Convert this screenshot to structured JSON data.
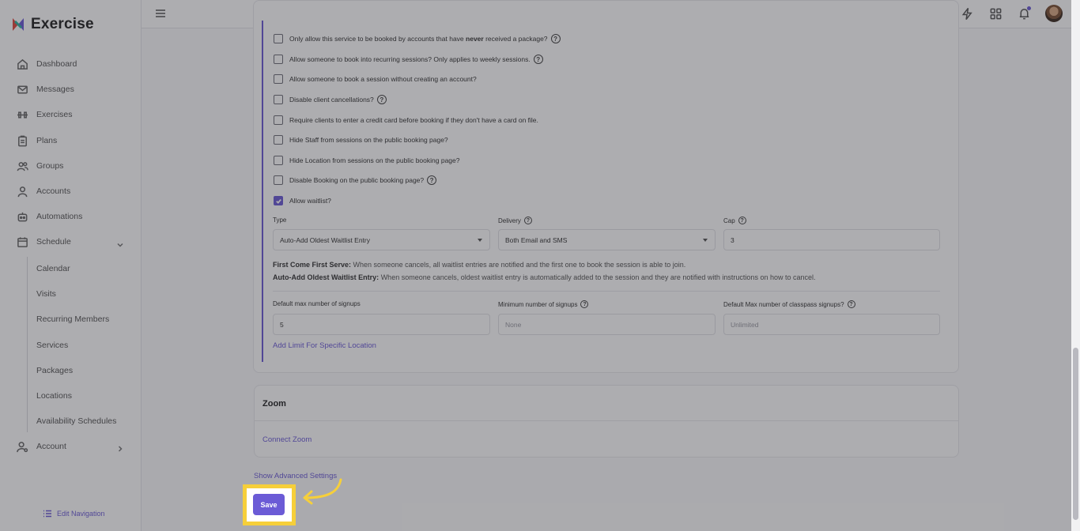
{
  "app": {
    "name": "Exercise"
  },
  "sidebar": {
    "items": [
      {
        "label": "Dashboard",
        "icon": "home-icon"
      },
      {
        "label": "Messages",
        "icon": "mail-icon"
      },
      {
        "label": "Exercises",
        "icon": "dumbbell-icon"
      },
      {
        "label": "Plans",
        "icon": "clipboard-icon"
      },
      {
        "label": "Groups",
        "icon": "users-icon"
      },
      {
        "label": "Accounts",
        "icon": "user-icon"
      },
      {
        "label": "Automations",
        "icon": "robot-icon"
      },
      {
        "label": "Schedule",
        "icon": "calendar-icon"
      }
    ],
    "schedule_sub": [
      "Calendar",
      "Visits",
      "Recurring Members",
      "Services",
      "Packages",
      "Locations",
      "Availability Schedules"
    ],
    "account": "Account",
    "edit_nav": "Edit Navigation"
  },
  "settings": {
    "opt1_pre": "Only allow this service to be booked by accounts that have",
    "opt1_bold": "never",
    "opt1_post": "received a package?",
    "opt2": "Allow someone to book into recurring sessions? Only applies to weekly sessions.",
    "opt3": "Allow someone to book a session without creating an account?",
    "opt4": "Disable client cancellations?",
    "opt5": "Require clients to enter a credit card before booking if they don't have a card on file.",
    "opt6": "Hide Staff from sessions on the public booking page?",
    "opt7": "Hide Location from sessions on the public booking page?",
    "opt8": "Disable Booking on the public booking page?",
    "opt9": "Allow waitlist?"
  },
  "waitlist": {
    "type_label": "Type",
    "type_value": "Auto-Add Oldest Waitlist Entry",
    "delivery_label": "Delivery",
    "delivery_value": "Both Email and SMS",
    "cap_label": "Cap",
    "cap_value": "3",
    "note1_bold": "First Come First Serve:",
    "note1_text": "When someone cancels, all waitlist entries are notified and the first one to book the session is able to join.",
    "note2_bold": "Auto-Add Oldest Waitlist Entry:",
    "note2_text": "When someone cancels, oldest waitlist entry is automatically added to the session and they are notified with instructions on how to cancel."
  },
  "signups": {
    "max_label": "Default max number of signups",
    "max_value": "5",
    "min_label": "Minimum number of signups",
    "min_placeholder": "None",
    "classpass_label": "Default Max number of classpass signups?",
    "classpass_placeholder": "Unlimited",
    "add_limit": "Add Limit For Specific Location"
  },
  "zoom": {
    "title": "Zoom",
    "connect": "Connect Zoom"
  },
  "advanced": "Show Advanced Settings",
  "save": "Save",
  "colors": {
    "accent": "#6b5bd6",
    "highlight": "#f6cf3a"
  }
}
